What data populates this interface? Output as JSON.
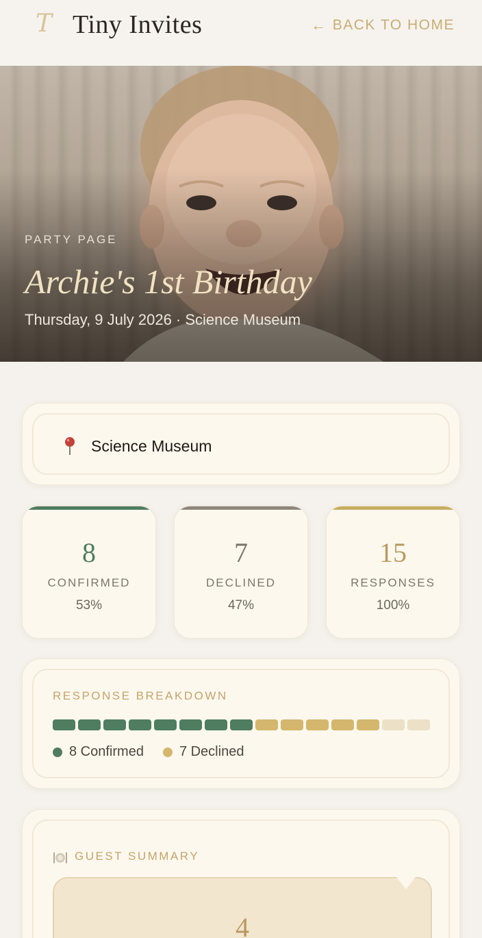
{
  "header": {
    "logo_letter": "T",
    "brand": "Tiny Invites",
    "back_label": "BACK TO HOME",
    "back_arrow": "←"
  },
  "hero": {
    "eyebrow": "PARTY PAGE",
    "title": "Archie's 1st Birthday",
    "subtitle": "Thursday, 9 July 2026 · Science Museum"
  },
  "venue": {
    "icon": "map-pin-icon",
    "name": "Science Museum"
  },
  "stats": [
    {
      "value": "8",
      "label": "CONFIRMED",
      "percent": "53%",
      "color": "#4e7d60"
    },
    {
      "value": "7",
      "label": "DECLINED",
      "percent": "47%",
      "color": "#8f877b"
    },
    {
      "value": "15",
      "label": "RESPONSES",
      "percent": "100%",
      "color": "#c7ad60"
    }
  ],
  "breakdown": {
    "title": "RESPONSE BREAKDOWN",
    "confirmed_count": 8,
    "declined_count": 5,
    "empty_count": 2,
    "confirmed_color": "#4e7d60",
    "declined_color": "#d4b76c",
    "empty_color": "#ece0c6",
    "legend_confirmed": "8 Confirmed",
    "legend_declined": "7 Declined"
  },
  "guest_summary": {
    "icon": "plate-cutlery-icon",
    "title": "GUEST SUMMARY",
    "value": "4"
  }
}
